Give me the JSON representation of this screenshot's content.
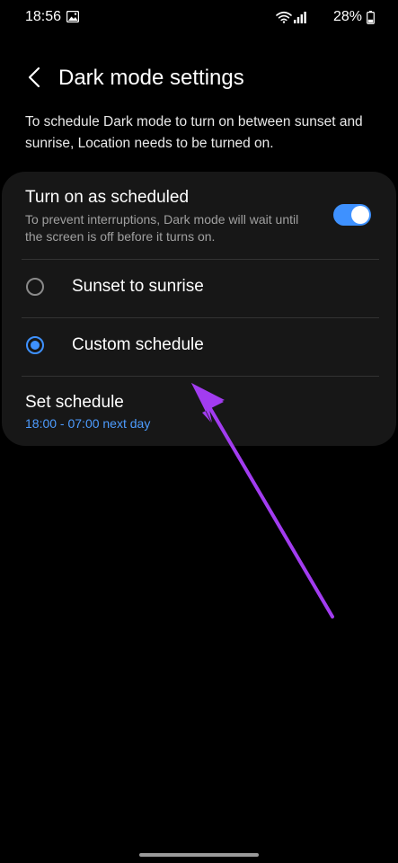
{
  "status_bar": {
    "time": "18:56",
    "battery": "28%",
    "icons": [
      "gallery-icon",
      "wifi-icon",
      "signal-icon",
      "battery-icon"
    ]
  },
  "header": {
    "title": "Dark mode settings",
    "back_icon": "chevron-left-icon"
  },
  "description": "To schedule Dark mode to turn on between sunset and sunrise, Location needs to be turned on.",
  "card": {
    "scheduled": {
      "title": "Turn on as scheduled",
      "subtitle": "To prevent interruptions, Dark mode will wait until the screen is off before it turns on.",
      "enabled": true
    },
    "options": [
      {
        "label": "Sunset to sunrise",
        "selected": false
      },
      {
        "label": "Custom schedule",
        "selected": true
      }
    ],
    "set_schedule": {
      "title": "Set schedule",
      "value": "18:00 - 07:00 next day"
    }
  },
  "colors": {
    "accent": "#3e91ff",
    "link": "#4d9cff",
    "card_bg": "#171717",
    "annotation_arrow": "#a23cf0"
  }
}
